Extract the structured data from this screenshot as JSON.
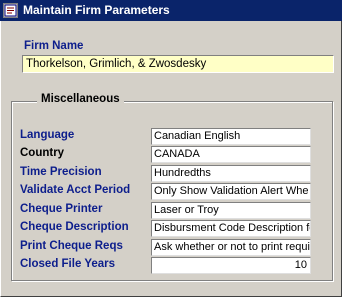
{
  "window": {
    "title": "Maintain Firm Parameters"
  },
  "firm": {
    "label": "Firm Name",
    "value": "Thorkelson, Grimlich, & Zwosdesky"
  },
  "misc": {
    "title": "Miscellaneous",
    "rows": [
      {
        "label": "Language",
        "value": "Canadian English"
      },
      {
        "label": "Country",
        "value": "CANADA"
      },
      {
        "label": "Time Precision",
        "value": "Hundredths"
      },
      {
        "label": "Validate Acct Period",
        "value": "Only Show Validation Alert Whe"
      },
      {
        "label": "Cheque Printer",
        "value": "Laser or Troy"
      },
      {
        "label": "Cheque Description",
        "value": "Disbursment Code Description fo"
      },
      {
        "label": "Print Cheque Reqs",
        "value": "Ask whether or not to print requis"
      },
      {
        "label": "Closed File Years",
        "value": "10"
      }
    ]
  }
}
